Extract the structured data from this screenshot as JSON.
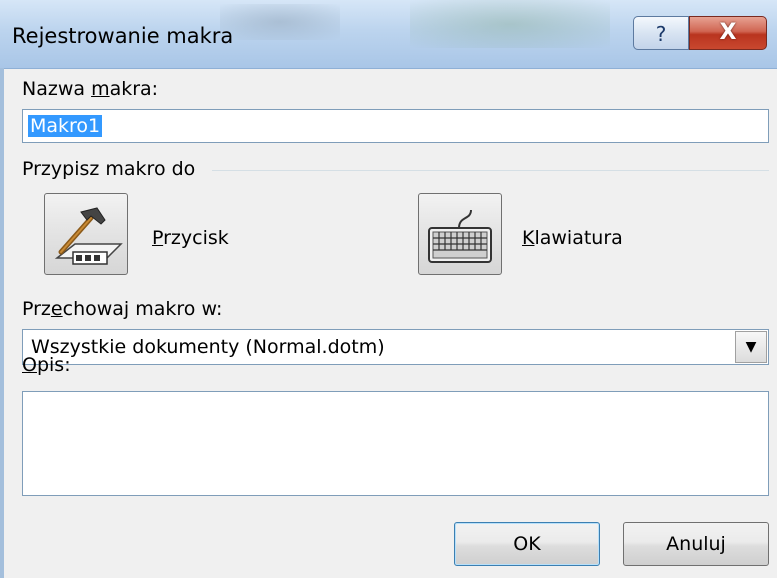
{
  "window": {
    "title": "Rejestrowanie makra",
    "help": "?",
    "close": "X"
  },
  "macro_name": {
    "label_pre": "Nazwa ",
    "label_ul": "m",
    "label_post": "akra:",
    "value": "Makro1"
  },
  "assign": {
    "label": "Przypisz makro do",
    "button": {
      "ul": "P",
      "rest": "rzycisk",
      "icon": "hammer-icon"
    },
    "keyboard": {
      "ul": "K",
      "rest": "lawiatura",
      "icon": "keyboard-icon"
    }
  },
  "store": {
    "label_pre": "Prz",
    "label_ul": "e",
    "label_post": "chowaj makro w:",
    "value": "Wszystkie dokumenty (Normal.dotm)"
  },
  "description": {
    "label_ul": "O",
    "label_post": "pis:",
    "value": ""
  },
  "buttons": {
    "ok": "OK",
    "cancel": "Anuluj"
  }
}
